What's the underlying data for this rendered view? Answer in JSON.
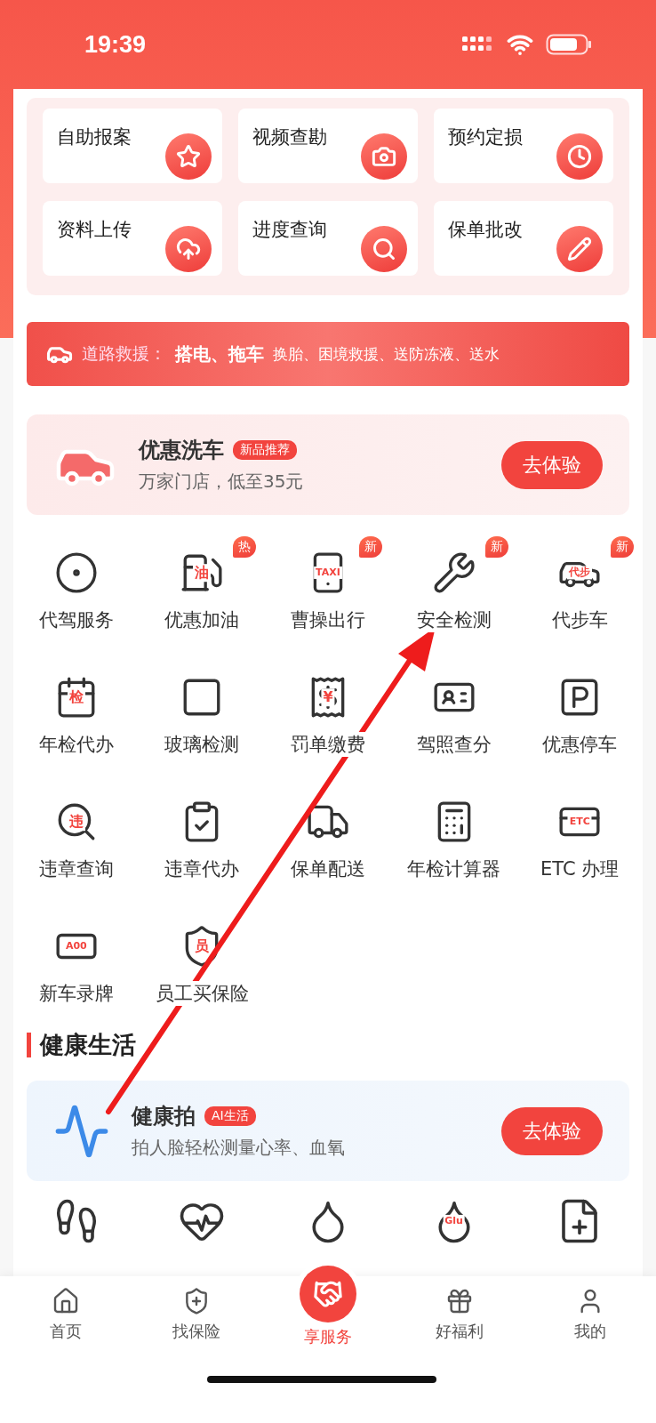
{
  "status_bar": {
    "time": "19:39"
  },
  "quick_services": [
    {
      "label": "自助报案"
    },
    {
      "label": "视频查勘"
    },
    {
      "label": "预约定损"
    },
    {
      "label": "资料上传"
    },
    {
      "label": "进度查询"
    },
    {
      "label": "保单批改"
    }
  ],
  "rescue_banner": {
    "title": "道路救援：",
    "highlight": "搭电、拖车",
    "rest": "换胎、困境救援、送防冻液、送水"
  },
  "promo_cards": [
    {
      "kind": "wash",
      "title": "优惠洗车",
      "tag": "新品推荐",
      "subtitle": "万家门店，低至35元",
      "button": "去体验"
    }
  ],
  "services": [
    {
      "label": "代驾服务"
    },
    {
      "label": "优惠加油",
      "glyph": "油",
      "badge": "热"
    },
    {
      "label": "曹操出行",
      "glyph": "TAXI",
      "badge": "新"
    },
    {
      "label": "安全检测",
      "badge": "新"
    },
    {
      "label": "代步车",
      "glyph": "代步",
      "badge": "新"
    },
    {
      "label": "年检代办",
      "glyph": "检"
    },
    {
      "label": "玻璃检测"
    },
    {
      "label": "罚单缴费",
      "glyph": "¥"
    },
    {
      "label": "驾照查分"
    },
    {
      "label": "优惠停车"
    },
    {
      "label": "违章查询",
      "glyph": "违"
    },
    {
      "label": "违章代办"
    },
    {
      "label": "保单配送"
    },
    {
      "label": "年检计算器"
    },
    {
      "label": "ETC 办理",
      "glyph": "ETC"
    },
    {
      "label": "新车录牌",
      "glyph": "A00"
    },
    {
      "label": "员工买保险",
      "glyph": "员"
    }
  ],
  "health": {
    "section_title": "健康生活",
    "card": {
      "kind": "health",
      "title": "健康拍",
      "tag": "AI生活",
      "subtitle": "拍人脸轻松测量心率、血氧",
      "button": "去体验"
    },
    "items": [
      {
        "kind": "shoe"
      },
      {
        "kind": "heart"
      },
      {
        "kind": "drop"
      },
      {
        "kind": "glucose",
        "glyph": "Glu"
      },
      {
        "kind": "report"
      }
    ]
  },
  "tab_bar": [
    {
      "label": "首页",
      "selected": false
    },
    {
      "label": "找保险",
      "selected": false
    },
    {
      "label": "享服务",
      "selected": true
    },
    {
      "label": "好福利",
      "selected": false
    },
    {
      "label": "我的",
      "selected": false
    }
  ]
}
